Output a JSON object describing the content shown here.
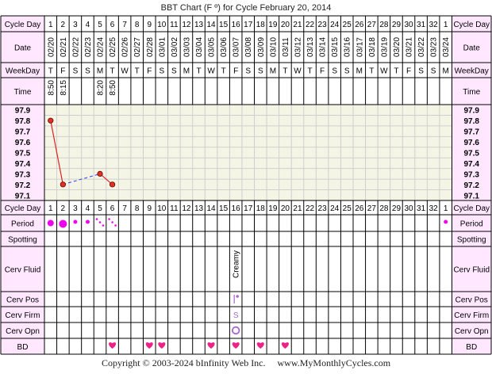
{
  "title": "BBT Chart (F º) for Cycle February 20, 2014",
  "copyright": "Copyright © 2003-2024 bInfinity Web Inc.     www.MyMonthlyCycles.com",
  "row_labels": {
    "cycle_day": "Cycle Day",
    "date": "Date",
    "weekday": "WeekDay",
    "time": "Time",
    "period": "Period",
    "spotting": "Spotting",
    "cerv_fluid": "Cerv Fluid",
    "cerv_pos": "Cerv Pos",
    "cerv_firm": "Cerv Firm",
    "cerv_opn": "Cerv Opn",
    "bd": "BD"
  },
  "cycle_days": [
    "1",
    "2",
    "3",
    "4",
    "5",
    "6",
    "7",
    "8",
    "9",
    "10",
    "11",
    "12",
    "13",
    "14",
    "15",
    "16",
    "17",
    "18",
    "19",
    "20",
    "21",
    "22",
    "23",
    "24",
    "25",
    "26",
    "27",
    "28",
    "29",
    "30",
    "31",
    "32",
    "1"
  ],
  "dates": [
    "02/20",
    "02/21",
    "02/22",
    "02/23",
    "02/24",
    "02/25",
    "02/26",
    "02/27",
    "02/28",
    "03/01",
    "03/02",
    "03/03",
    "03/04",
    "03/05",
    "03/06",
    "03/07",
    "03/08",
    "03/09",
    "03/10",
    "03/11",
    "03/12",
    "03/13",
    "03/14",
    "03/15",
    "03/16",
    "03/17",
    "03/18",
    "03/19",
    "03/20",
    "03/21",
    "03/22",
    "03/23",
    "03/24"
  ],
  "weekdays": [
    "T",
    "F",
    "S",
    "S",
    "M",
    "T",
    "W",
    "T",
    "F",
    "S",
    "S",
    "M",
    "T",
    "W",
    "T",
    "F",
    "S",
    "S",
    "M",
    "T",
    "W",
    "T",
    "F",
    "S",
    "S",
    "M",
    "T",
    "W",
    "T",
    "F",
    "S",
    "S",
    "M"
  ],
  "times": [
    "8:50",
    "8:15",
    "",
    "",
    "8:20",
    "8:50",
    "",
    "",
    "",
    "",
    "",
    "",
    "",
    "",
    "",
    "",
    "",
    "",
    "",
    "",
    "",
    "",
    "",
    "",
    "",
    "",
    "",
    "",
    "",
    "",
    "",
    "",
    ""
  ],
  "temp_labels": [
    "97.9",
    "97.8",
    "97.7",
    "97.6",
    "97.5",
    "97.4",
    "97.3",
    "97.2",
    "97.1"
  ],
  "cerv_fluid_text": "Creamy",
  "cerv_firm_text": "S",
  "colors": {
    "label_bg": "#ffe8ff",
    "chart_bg": "#f5f5e6",
    "grid": "#cfcfcf",
    "border": "#000000",
    "temp_line": "#dd2222",
    "temp_point": "#dd3322",
    "dash_line": "#3344ee",
    "period": "#ee00ee",
    "bd": "#ee2288",
    "cerv": "#aa66cc"
  },
  "chart_data": {
    "type": "line",
    "title": "BBT Chart (F º) for Cycle February 20, 2014",
    "x_label": "Cycle Day",
    "y_label": "",
    "x": [
      1,
      2,
      3,
      4,
      5,
      6,
      7,
      8,
      9,
      10,
      11,
      12,
      13,
      14,
      15,
      16,
      17,
      18,
      19,
      20,
      21,
      22,
      23,
      24,
      25,
      26,
      27,
      28,
      29,
      30,
      31,
      32,
      33
    ],
    "ylim": [
      97.05,
      97.95
    ],
    "y_ticks": [
      97.1,
      97.2,
      97.3,
      97.4,
      97.5,
      97.6,
      97.7,
      97.8,
      97.9
    ],
    "grid": true,
    "temperatures": [
      {
        "day": 1,
        "temp": 97.8
      },
      {
        "day": 2,
        "temp": 97.2
      },
      {
        "day": 5,
        "temp": 97.3
      },
      {
        "day": 6,
        "temp": 97.2
      }
    ],
    "solid_segments": [
      [
        1,
        2
      ],
      [
        5,
        6
      ]
    ],
    "dashed_segments": [
      [
        2,
        5
      ]
    ],
    "period": [
      {
        "day": 1,
        "level": "medium"
      },
      {
        "day": 2,
        "level": "heavy"
      },
      {
        "day": 3,
        "level": "light"
      },
      {
        "day": 4,
        "level": "light"
      },
      {
        "day": 5,
        "level": "spotting"
      },
      {
        "day": 6,
        "level": "spotting"
      },
      {
        "day": 33,
        "level": "light"
      }
    ],
    "cerv_fluid": [
      {
        "day": 16,
        "value": "Creamy"
      }
    ],
    "cerv_pos": [
      {
        "day": 16,
        "value": "low"
      }
    ],
    "cerv_firm": [
      {
        "day": 16,
        "value": "S"
      }
    ],
    "cerv_opn": [
      {
        "day": 16,
        "value": "open"
      }
    ],
    "bd_days": [
      6,
      9,
      10,
      14,
      16,
      18,
      20
    ]
  }
}
